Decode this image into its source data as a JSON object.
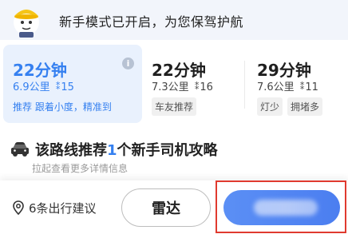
{
  "banner": {
    "message": "新手模式已开启，为您保驾护航"
  },
  "routes": [
    {
      "time": "22分钟",
      "distance": "6.9公里",
      "traffic_lights": "15",
      "tags": [
        "推荐 跟着小度，精准到"
      ],
      "selected": true
    },
    {
      "time": "22分钟",
      "distance": "7.3公里",
      "traffic_lights": "16",
      "tags": [
        "车友推荐"
      ],
      "selected": false
    },
    {
      "time": "29分钟",
      "distance": "7.6公里",
      "traffic_lights": "11",
      "tags": [
        "灯少",
        "拥堵多"
      ],
      "selected": false
    }
  ],
  "recommendation": {
    "title_prefix": "该路线推荐",
    "count": "1",
    "title_suffix": "个新手司机攻略",
    "subtitle": "拉起查看更多详情信息"
  },
  "bottom_bar": {
    "trip_advice": "6条出行建议",
    "radar_button": "雷达"
  },
  "colors": {
    "accent": "#3580f0",
    "go_button": "#4b7ef0",
    "highlight_frame": "#e03a2f"
  }
}
